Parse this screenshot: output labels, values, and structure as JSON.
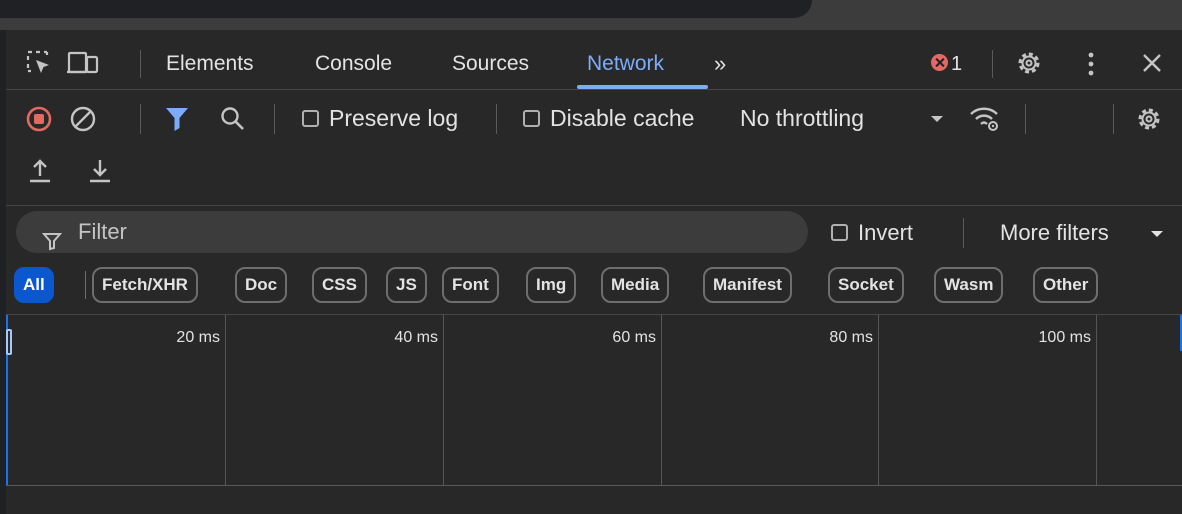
{
  "tabs": {
    "items": [
      "Elements",
      "Console",
      "Sources",
      "Network"
    ],
    "active": "Network",
    "overflow_label": "»",
    "error_count": "1",
    "close_label": "✕"
  },
  "toolbar": {
    "preserve_log_label": "Preserve log",
    "preserve_log_checked": false,
    "disable_cache_label": "Disable cache",
    "disable_cache_checked": false,
    "throttling_value": "No throttling"
  },
  "filter": {
    "placeholder": "Filter",
    "invert_label": "Invert",
    "more_filters_label": "More filters"
  },
  "types": {
    "all": "All",
    "items": [
      "Fetch/XHR",
      "Doc",
      "CSS",
      "JS",
      "Font",
      "Img",
      "Media",
      "Manifest",
      "Socket",
      "Wasm",
      "Other"
    ],
    "active": "All"
  },
  "timeline": {
    "ticks": [
      "20 ms",
      "40 ms",
      "60 ms",
      "80 ms",
      "100 ms"
    ]
  },
  "colors": {
    "accent": "#7cacf8",
    "record_red": "#e46962",
    "filter_blue": "#7cacf8",
    "chip_active": "#0b57d0"
  }
}
